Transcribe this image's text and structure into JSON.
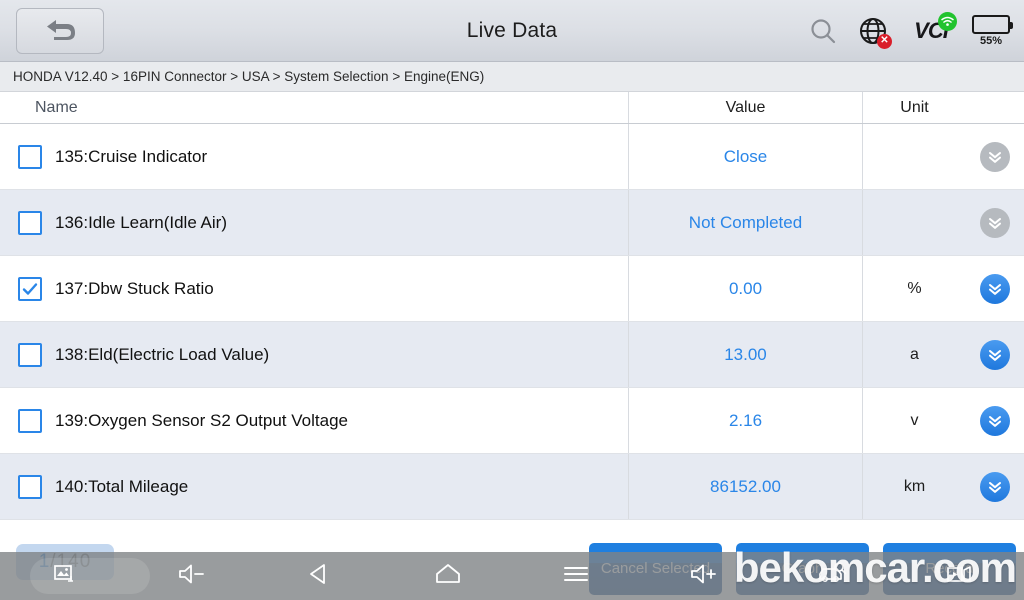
{
  "header": {
    "title": "Live Data",
    "back_icon": "back-arrow-icon",
    "search_icon": "search-icon",
    "globe_icon": "globe-disconnected-icon",
    "vci_label": "VCI",
    "wifi_icon": "wifi-icon",
    "battery_percent": "55%",
    "battery_level": 55
  },
  "breadcrumb": {
    "text": "HONDA V12.40 > 16PIN Connector  > USA  > System Selection  > Engine(ENG)"
  },
  "table": {
    "columns": [
      "Name",
      "Value",
      "Unit"
    ],
    "rows": [
      {
        "name": "135:Cruise Indicator",
        "value": "Close",
        "unit": "",
        "checked": false,
        "expand_active": false
      },
      {
        "name": "136:Idle Learn(Idle Air)",
        "value": "Not Completed",
        "unit": "",
        "checked": false,
        "expand_active": false
      },
      {
        "name": "137:Dbw Stuck Ratio",
        "value": "0.00",
        "unit": "%",
        "checked": true,
        "expand_active": true
      },
      {
        "name": "138:Eld(Electric Load Value)",
        "value": "13.00",
        "unit": "a",
        "checked": false,
        "expand_active": true
      },
      {
        "name": "139:Oxygen Sensor S2 Output Voltage",
        "value": "2.16",
        "unit": "v",
        "checked": false,
        "expand_active": true
      },
      {
        "name": "140:Total Mileage",
        "value": "86152.00",
        "unit": "km",
        "checked": false,
        "expand_active": true
      }
    ]
  },
  "footer": {
    "page_current": "1",
    "page_total": "/140",
    "buttons": [
      {
        "label": "Cancel Selected"
      },
      {
        "label": "Graph"
      },
      {
        "label": "Record"
      }
    ]
  },
  "navbar": {
    "items": [
      {
        "icon": "screenshot-icon"
      },
      {
        "icon": "volume-down-icon"
      },
      {
        "icon": "back-triangle-icon"
      },
      {
        "icon": "home-icon"
      },
      {
        "icon": "menu-icon"
      },
      {
        "icon": "volume-up-icon"
      },
      {
        "icon": "car-scan-icon"
      },
      {
        "icon": "record-video-icon"
      }
    ]
  },
  "watermark": {
    "text": "bekomcar.com"
  },
  "colors": {
    "accent_blue": "#2a86e8",
    "value_blue": "#2a86e8",
    "row_alt": "#e6eaf2",
    "button_blue": "#1f7fe0",
    "battery_dark": "#1a1a1a",
    "error_red": "#d91e2a",
    "wifi_green": "#22c32e"
  }
}
